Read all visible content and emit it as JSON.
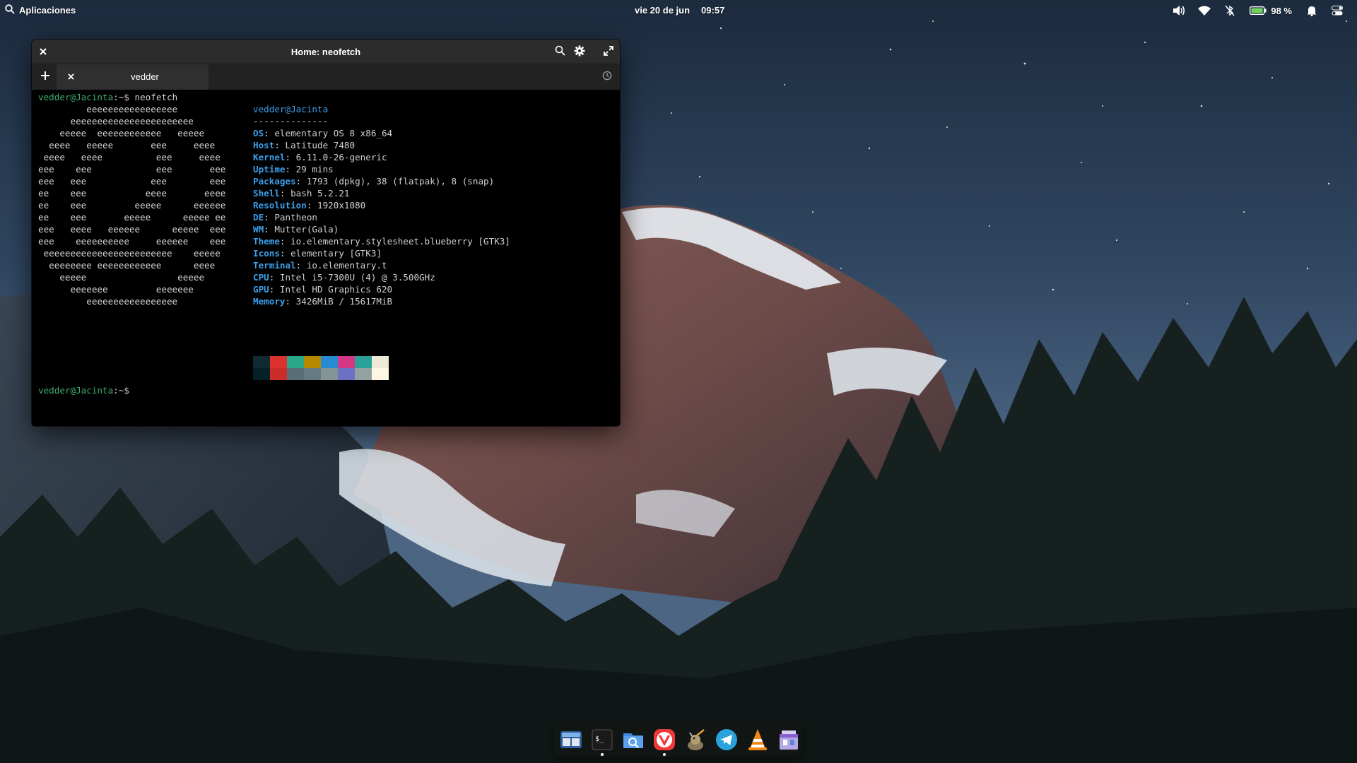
{
  "colors": {
    "accent_green": "#3daf6f",
    "accent_blue": "#3c9ee8",
    "terminal_bg": "#000000",
    "titlebar_bg": "#2c2c2c"
  },
  "panel": {
    "apps_label": "Aplicaciones",
    "date": "vie 20 de jun",
    "time": "09:57",
    "battery_percent": "98 %",
    "battery_level": 0.98,
    "icons": [
      "volume-icon",
      "wifi-icon",
      "bluetooth-off-icon",
      "battery-icon",
      "notifications-bell-icon",
      "session-toggle-icon"
    ]
  },
  "terminal": {
    "title": "Home: neofetch",
    "tab_label": "vedder",
    "prompt_user": "vedder@Jacinta",
    "prompt_sep": ":~$",
    "command": " neofetch",
    "info_header": "vedder@Jacinta",
    "underline": "--------------",
    "info": [
      {
        "key": "OS",
        "value": ": elementary OS 8 x86_64"
      },
      {
        "key": "Host",
        "value": ": Latitude 7480"
      },
      {
        "key": "Kernel",
        "value": ": 6.11.0-26-generic"
      },
      {
        "key": "Uptime",
        "value": ": 29 mins"
      },
      {
        "key": "Packages",
        "value": ": 1793 (dpkg), 38 (flatpak), 8 (snap)"
      },
      {
        "key": "Shell",
        "value": ": bash 5.2.21"
      },
      {
        "key": "Resolution",
        "value": ": 1920x1080"
      },
      {
        "key": "DE",
        "value": ": Pantheon"
      },
      {
        "key": "WM",
        "value": ": Mutter(Gala)"
      },
      {
        "key": "Theme",
        "value": ": io.elementary.stylesheet.blueberry [GTK3]"
      },
      {
        "key": "Icons",
        "value": ": elementary [GTK3]"
      },
      {
        "key": "Terminal",
        "value": ": io.elementary.t"
      },
      {
        "key": "CPU",
        "value": ": Intel i5-7300U (4) @ 3.500GHz"
      },
      {
        "key": "GPU",
        "value": ": Intel HD Graphics 620"
      },
      {
        "key": "Memory",
        "value": ": 3426MiB / 15617MiB"
      }
    ],
    "ascii_art": [
      "         eeeeeeeeeeeeeeeee",
      "      eeeeeeeeeeeeeeeeeeeeeee",
      "    eeeee  eeeeeeeeeeee   eeeee",
      "  eeee   eeeee       eee     eeee",
      " eeee   eeee          eee     eeee",
      "eee    eee            eee       eee",
      "eee   eee            eee        eee",
      "ee    eee           eeee       eeee",
      "ee    eee         eeeee      eeeeee",
      "ee    eee       eeeee      eeeee ee",
      "eee   eeee   eeeeee      eeeee  eee",
      "eee    eeeeeeeeee     eeeeee    eee",
      " eeeeeeeeeeeeeeeeeeeeeeee    eeeee",
      "  eeeeeeee eeeeeeeeeeee      eeee",
      "    eeeee                 eeeee",
      "      eeeeeee         eeeeeee",
      "         eeeeeeeeeeeeeeeee"
    ],
    "palette_top": [
      "#0f2a33",
      "#dc322f",
      "#2aa889",
      "#b58900",
      "#268bd2",
      "#d33682",
      "#2aa198",
      "#eee8d5"
    ],
    "palette_bottom": [
      "#06202a",
      "#cb2d2b",
      "#586e75",
      "#657b83",
      "#839496",
      "#6c71c4",
      "#93a1a1",
      "#fdf6e3"
    ]
  },
  "dock": {
    "items": [
      {
        "name": "multitasking-view-icon",
        "running": false
      },
      {
        "name": "terminal-icon",
        "running": true
      },
      {
        "name": "files-icon",
        "running": false
      },
      {
        "name": "vivaldi-browser-icon",
        "running": true
      },
      {
        "name": "gimp-icon",
        "running": false
      },
      {
        "name": "telegram-icon",
        "running": false
      },
      {
        "name": "vlc-icon",
        "running": false
      },
      {
        "name": "appcenter-icon",
        "running": false
      }
    ]
  }
}
